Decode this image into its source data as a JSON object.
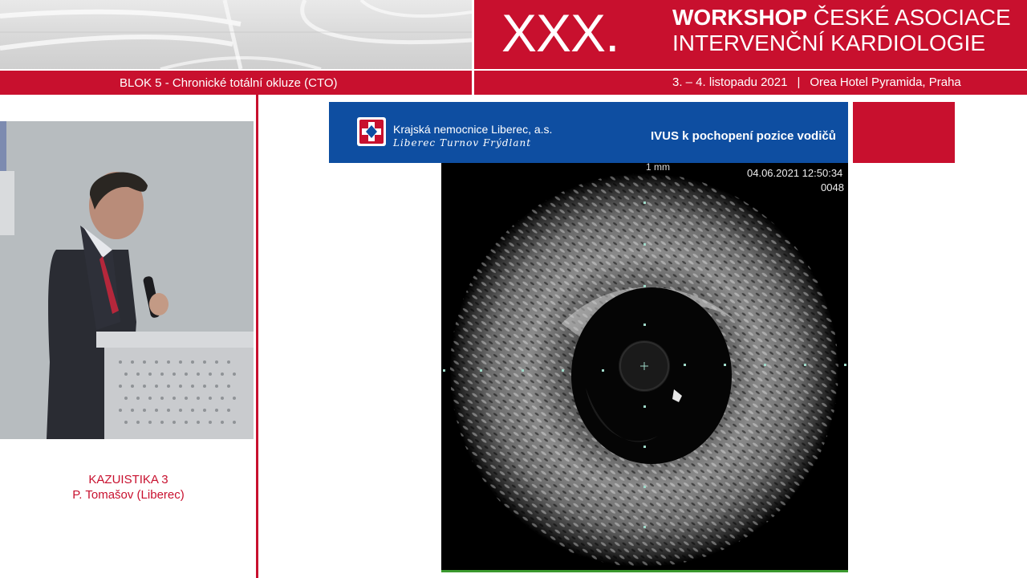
{
  "header": {
    "edition": "XXX.",
    "title_bold": "WORKSHOP",
    "title_rest": "ČESKÉ ASOCIACE",
    "title_line2": "INTERVENČNÍ KARDIOLOGIE",
    "block_label": "BLOK 5 - Chronické totální okluze (CTO)",
    "dates": "3. – 4. listopadu 2021",
    "separator": "|",
    "venue": "Orea Hotel Pyramida, Praha"
  },
  "speaker": {
    "case_label": "KAZUISTIKA 3",
    "name": "P. Tomašov (Liberec)"
  },
  "slide": {
    "hospital_name": "Krajská nemocnice Liberec, a.s.",
    "hospital_towns": "Liberec  Turnov  Frýdlant",
    "title": "IVUS k pochopení pozice vodičů",
    "ivus": {
      "scale_label": "1 mm",
      "timestamp": "04.06.2021 12:50:34",
      "frame": "0048"
    }
  },
  "colors": {
    "brand_red": "#c8102e",
    "hospital_blue": "#0e4ea1",
    "green_line": "#3b9a2f"
  },
  "icons": [
    "hospital-cross-logo"
  ]
}
